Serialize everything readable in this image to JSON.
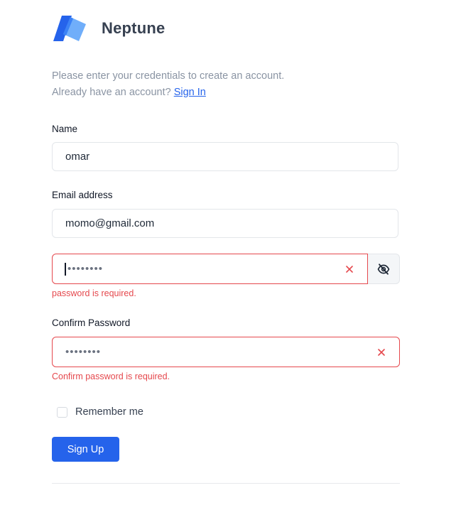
{
  "brand": {
    "name": "Neptune",
    "logo_icon": "neptune-logo-icon",
    "primary_color": "#2563eb",
    "secondary_color": "#60a5fa"
  },
  "intro": {
    "line1": "Please enter your credentials to create an account.",
    "line2_prefix": "Already have an account? ",
    "signin_link": "Sign In"
  },
  "form": {
    "name": {
      "label": "Name",
      "value": "omar"
    },
    "email": {
      "label": "Email address",
      "value": "momo@gmail.com"
    },
    "password": {
      "value": "••••••••",
      "error": "password is required.",
      "clear_icon": "close-icon",
      "toggle_icon": "eye-slash-icon"
    },
    "confirm_password": {
      "label": "Confirm Password",
      "value": "••••••••",
      "error": "Confirm password is required.",
      "clear_icon": "close-icon"
    },
    "remember_me": {
      "label": "Remember me",
      "checked": false
    },
    "submit_label": "Sign Up"
  },
  "colors": {
    "error": "#e5484d",
    "border": "#e3e6ea",
    "muted_text": "#8a94a3"
  }
}
